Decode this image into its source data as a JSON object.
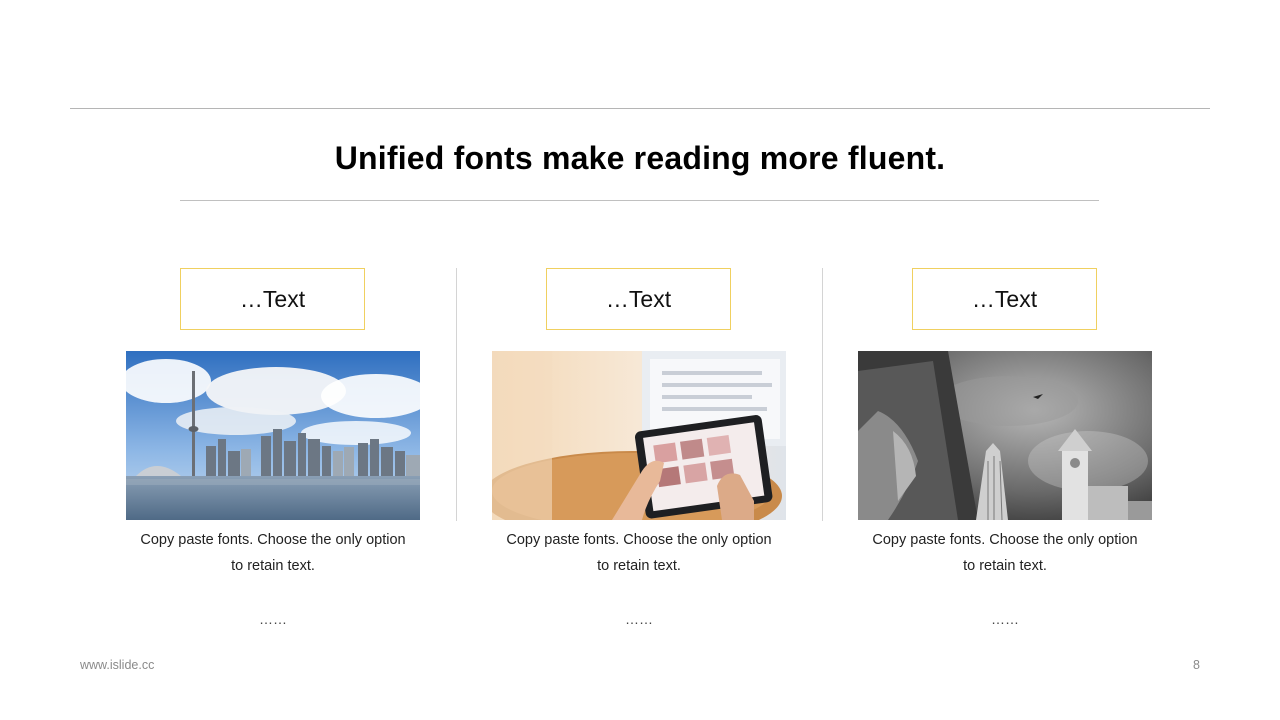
{
  "slide": {
    "title": "Unified fonts make reading more fluent.",
    "columns": [
      {
        "label": "…Text",
        "caption_line1": "Copy paste fonts. Choose the only option",
        "caption_line2": "to retain text.",
        "more": "……",
        "image": "city-skyline-photo"
      },
      {
        "label": "…Text",
        "caption_line1": "Copy paste fonts. Choose the only option",
        "caption_line2": "to retain text.",
        "more": "……",
        "image": "tablet-hands-photo"
      },
      {
        "label": "…Text",
        "caption_line1": "Copy paste fonts. Choose the only option",
        "caption_line2": "to retain text.",
        "more": "……",
        "image": "bw-buildings-photo"
      }
    ],
    "colors": {
      "box_border": "#f0d060",
      "rule": "#b5b5b5"
    }
  },
  "footer": {
    "url": "www.islide.cc",
    "page_number": "8"
  }
}
